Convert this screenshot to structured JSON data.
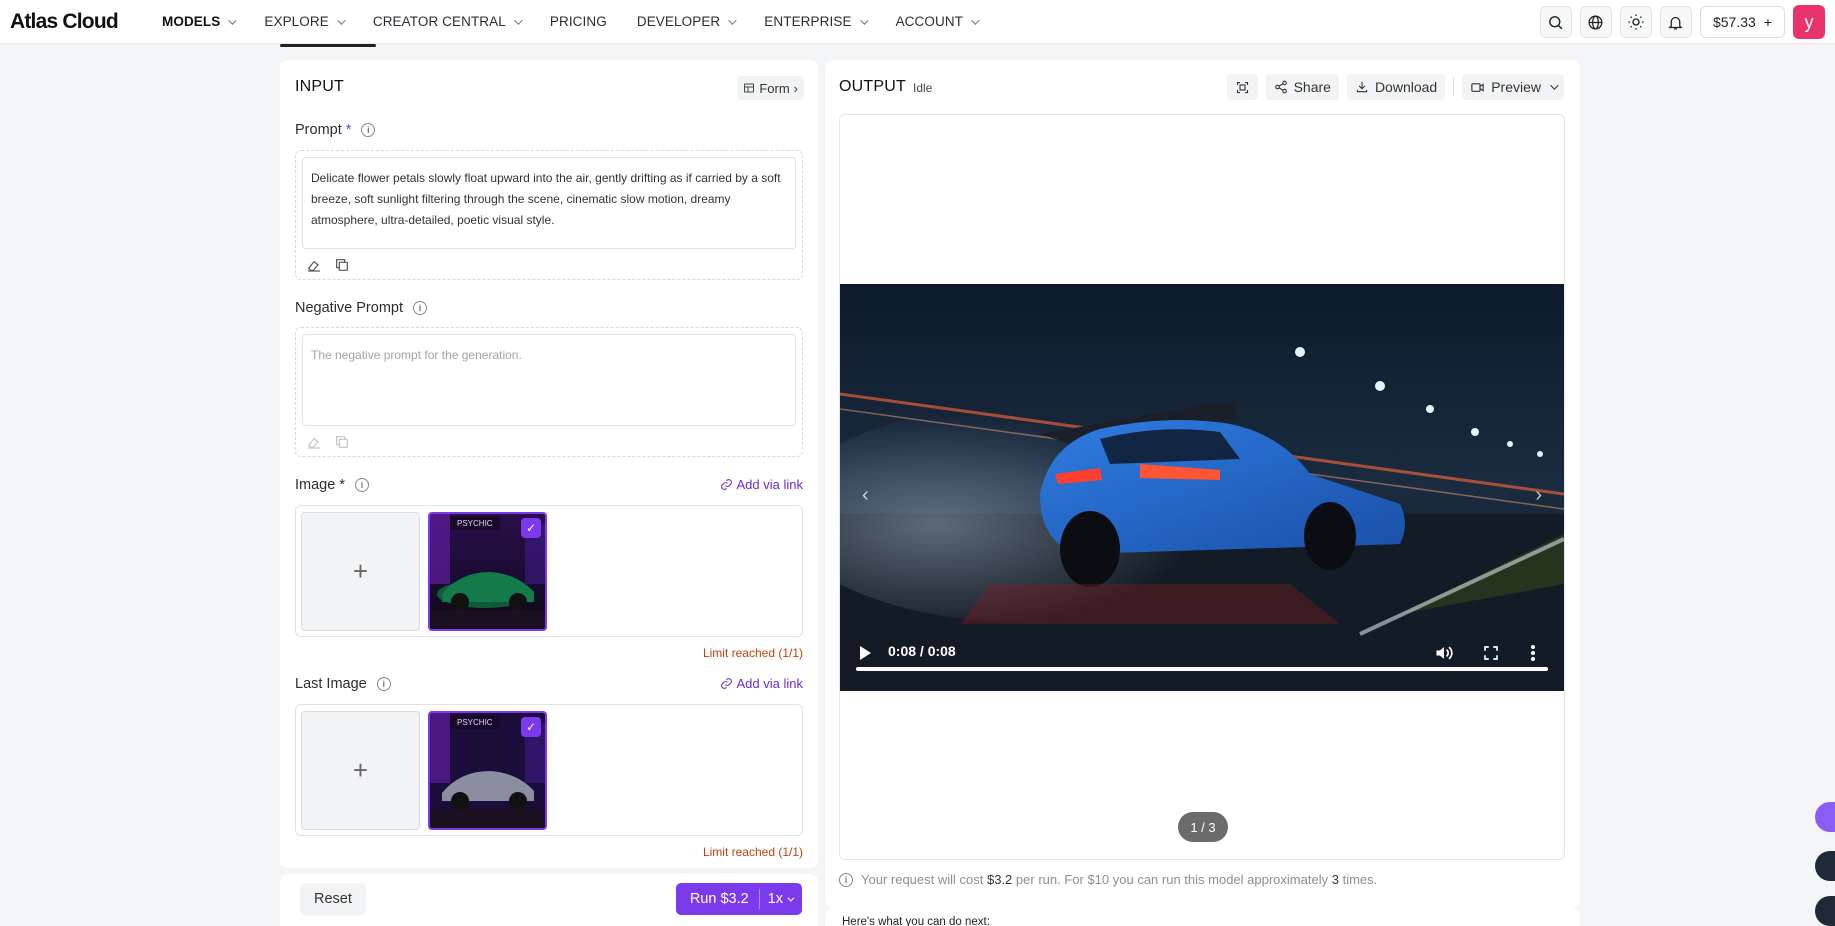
{
  "app": {
    "logo": "Atlas Cloud"
  },
  "nav": {
    "items": [
      {
        "label": "MODELS"
      },
      {
        "label": "EXPLORE"
      },
      {
        "label": "CREATOR CENTRAL"
      },
      {
        "label": "PRICING"
      },
      {
        "label": "DEVELOPER"
      },
      {
        "label": "ENTERPRISE"
      },
      {
        "label": "ACCOUNT"
      }
    ],
    "balance": "$57.33",
    "balance_add": "+",
    "avatar_letter": "y"
  },
  "input": {
    "title": "INPUT",
    "form_label": "Form",
    "prompt": {
      "label": "Prompt",
      "required": "*",
      "value": "Delicate flower petals slowly float upward into the air, gently drifting as if carried by a soft breeze, soft sunlight filtering through the scene, cinematic slow motion, dreamy atmosphere, ultra-detailed, poetic visual style."
    },
    "negative_prompt": {
      "label": "Negative Prompt",
      "placeholder": "The negative prompt for the generation."
    },
    "image": {
      "label": "Image",
      "required": "*",
      "add_link": "Add via link",
      "limit": "Limit reached (1/1)",
      "thumb_sign": "PSYCHIC"
    },
    "last_image": {
      "label": "Last Image",
      "add_link": "Add via link",
      "limit": "Limit reached (1/1)",
      "thumb_sign": "PSYCHIC"
    },
    "reset_label": "Reset",
    "run_label": "Run $3.2",
    "multiplier": "1x"
  },
  "output": {
    "title": "OUTPUT",
    "status": "Idle",
    "share_label": "Share",
    "download_label": "Download",
    "preview_label": "Preview",
    "video_time": "0:08 / 0:08",
    "video_progress": 1.0,
    "pager": "1 / 3",
    "cost_prefix": "Your request will cost",
    "cost_amount": "$3.2",
    "cost_mid": "per run. For $10 you can run this model approximately",
    "cost_runs": "3",
    "cost_suffix": "times.",
    "next_label": "Here's what you can do next:"
  },
  "colors": {
    "accent": "#7c3aed",
    "limit": "#c2410c",
    "avatar": "#e8336d"
  }
}
